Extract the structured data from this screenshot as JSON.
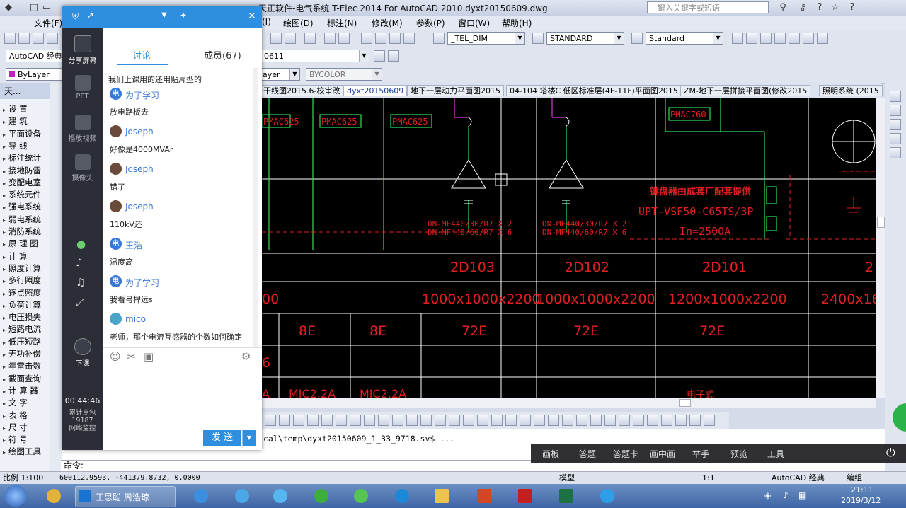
{
  "window": {
    "title": "天正软件-电气系统 T-Elec 2014  For AutoCAD 2010    dyxt20150609.dwg",
    "search_placeholder": "键入关键字或短语"
  },
  "menu": [
    "文件(F)",
    "(I)",
    "绘图(D)",
    "标注(N)",
    "修改(M)",
    "参数(P)",
    "窗口(W)",
    "帮助(H)"
  ],
  "toolbar": {
    "workspace": "AutoCAD 经典",
    "dimstyle": "_TEL_DIM",
    "textstyle": "STANDARD",
    "tablestyle": "Standard",
    "layer_value": "0611",
    "color": "ByLayer",
    "linetype": "ayer",
    "plotstyle": "BYCOLOR"
  },
  "doc_tabs": [
    {
      "label": "干线图2015.6-校审改",
      "active": false
    },
    {
      "label": "dyxt20150609",
      "active": true
    },
    {
      "label": "地下一层动力平面图2015",
      "active": false
    },
    {
      "label": "04-104 塔楼C 低区标准层(4F-11F)平面图2015",
      "active": false
    },
    {
      "label": "ZM-地下一层拼接平面图(修改2015",
      "active": false
    },
    {
      "label": "照明系统 (2015",
      "active": false
    }
  ],
  "left_panel": {
    "header": "天...",
    "items": [
      "设  置",
      "建  筑",
      "平面设备",
      "导  线",
      "标注统计",
      "接地防雷",
      "变配电室",
      "系统元件",
      "强电系统",
      "弱电系统",
      "消防系统",
      "原 理 图",
      "计  算",
      "照度计算",
      "多行照度",
      "逐点照度",
      "负荷计算",
      "电压损失",
      "短路电流",
      "低压短路",
      "无功补偿",
      "年雷击数",
      "截面查询",
      "计 算 器",
      "文  字",
      "表  格",
      "尺  寸",
      "符  号",
      "绘图工具"
    ]
  },
  "chat": {
    "tabs": [
      "讨论",
      "成员(67)"
    ],
    "sidebar": [
      {
        "label": "分享屏幕",
        "active": true
      },
      {
        "label": "PPT",
        "active": false
      },
      {
        "label": "播放视频",
        "active": false
      },
      {
        "label": "摄像头",
        "active": false
      },
      {
        "label": "下课",
        "active": false
      }
    ],
    "timer": "00:44:46",
    "stats": [
      "累计点包",
      "19187",
      "网络监控"
    ],
    "first_line": "我们上课用的还用贴片型的",
    "messages": [
      {
        "name": "为了学习",
        "text": "放电路板去",
        "avatar": "电",
        "color": "#3a78d6"
      },
      {
        "name": "Joseph",
        "text": "好像是4000MVAr",
        "avatar": "",
        "color": "#6a4a3a"
      },
      {
        "name": "Joseph",
        "text": "错了",
        "avatar": "",
        "color": "#6a4a3a"
      },
      {
        "name": "Joseph",
        "text": "110kV还",
        "avatar": "",
        "color": "#6a4a3a"
      },
      {
        "name": "王浩",
        "text": "温度高",
        "avatar": "电",
        "color": "#3a78d6"
      },
      {
        "name": "为了学习",
        "text": "我看弓桿远s",
        "avatar": "电",
        "color": "#3a78d6"
      },
      {
        "name": "mico",
        "text": "老师，那个电流互感器的个数如何确定",
        "avatar": "",
        "color": "#4aa3c8"
      }
    ],
    "send_label": "发 送"
  },
  "cad": {
    "tags": [
      "PMAC625",
      "PMAC625",
      "PMAC625",
      "PMAC760"
    ],
    "red_note": "键盘器由成套厂配套提供",
    "upt_text": "UPT-VSF50-C65TS/3P",
    "in_text": "In=2500A",
    "dn1": [
      "DN-MF440/30/R7 X 2",
      "DN-MF440/60/R7 X 6"
    ],
    "dn2": [
      "DN-MF440/30/R7 X 2",
      "DN-MF440/60/R7 X 6"
    ],
    "ids": [
      "2D103",
      "2D102",
      "2D101",
      "2"
    ],
    "dims": [
      "00",
      "1000x1000x2200",
      "1000x1000x2200",
      "1200x1000x2200",
      "2400x16"
    ],
    "codes": [
      "8E",
      "8E",
      "72E",
      "72E",
      "72E"
    ],
    "row4": [
      "6"
    ],
    "row5": [
      "A",
      "MIC2.2A",
      "MIC2.2A",
      "电子式"
    ]
  },
  "command": {
    "history": "cal\\temp\\dyxt20150609_1_33_9718.sv$ ...",
    "prompt": "命令:"
  },
  "overlay_bar": [
    "画板",
    "答题",
    "答题卡",
    "画中画",
    "举手",
    "预览",
    "工具"
  ],
  "status": {
    "scale": "比例 1:100",
    "coords": "600112.9593, -441379.8732, 0.0000",
    "model": "模型",
    "anno_scale": "1:1",
    "workspace": "AutoCAD 经典",
    "group": "编组"
  },
  "taskbar": {
    "window_label": "王思聪 周浩琼",
    "time": "21:11",
    "date": "2019/3/12"
  }
}
